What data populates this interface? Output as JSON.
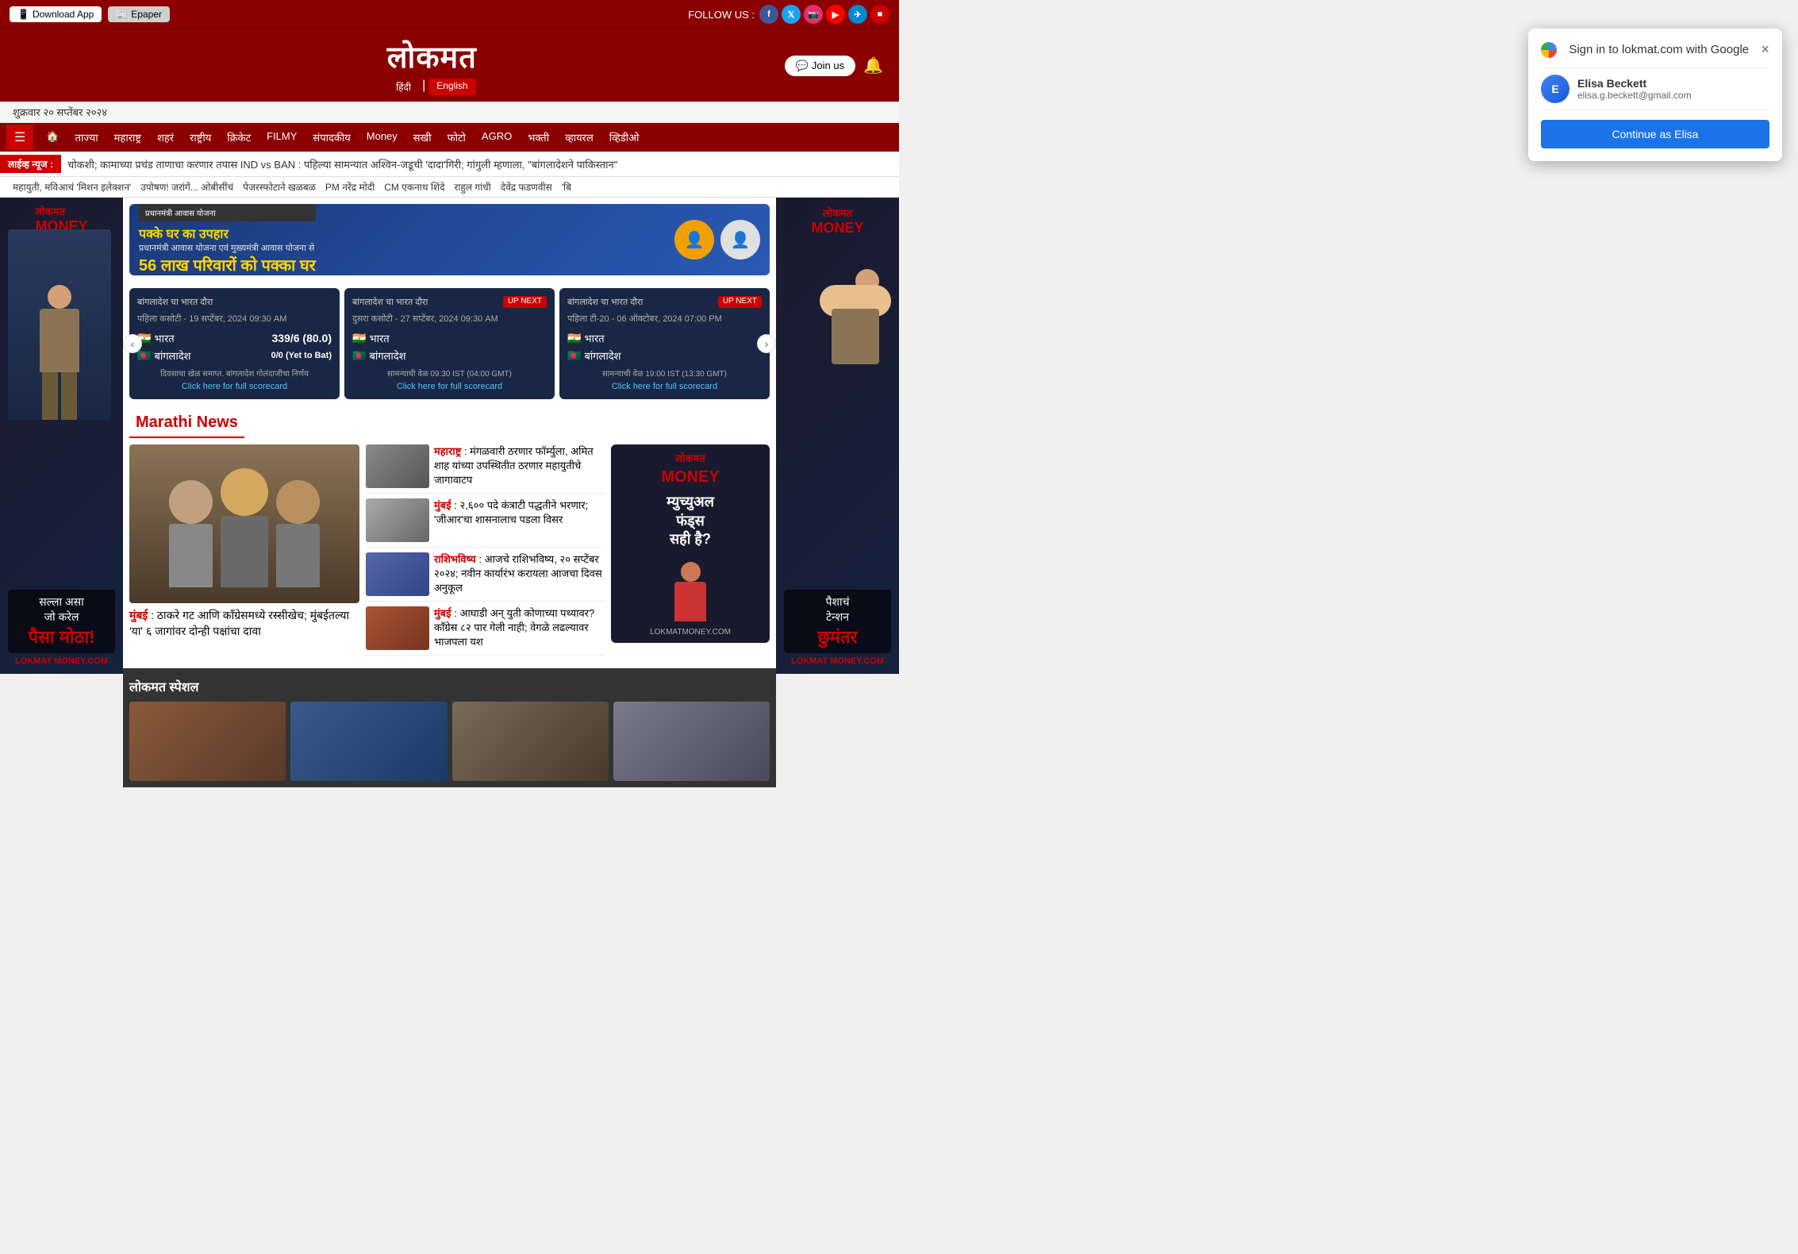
{
  "topbar": {
    "download_label": "Download App",
    "epaper_label": "Epaper",
    "follow_label": "FOLLOW US :",
    "social": [
      "f",
      "t",
      "ig",
      "yt",
      "tg"
    ]
  },
  "header": {
    "logo": "लोकमत",
    "lang_hindi": "हिंदी",
    "lang_english": "English",
    "join_label": "Join us"
  },
  "date_bar": {
    "date": "शुक्रवार २० सप्तेंबर २०२४"
  },
  "nav": {
    "hamburger": "☰",
    "items": [
      "🏠",
      "ताज्या",
      "महाराष्ट्र",
      "शहरं",
      "राष्ट्रीय",
      "क्रिकेट",
      "FILMY",
      "संपादकीय",
      "Money",
      "सखी",
      "फोटो",
      "AGRO",
      "भक्ती",
      "व्हायरल",
      "व्हिडीओ"
    ]
  },
  "breaking": {
    "label": "लाईव्ह न्यूज :",
    "text": "चोकशी; कामाच्या प्रचंड ताणाचा करणार तपास    IND vs BAN : पहिल्या सामन्यात अश्विन-जडूची 'दादा'गिरी; गांगुली म्हणाला, \"बांगलादेशने पाकिस्तान\""
  },
  "quick_links": [
    "महायुती, मविआचं 'मिशन इलेक्शन'",
    "उपोषण! जरांगें... ओबीसींचं",
    "पेजरस्फोटाने खळबळ",
    "PM नरेंद्र मोदी",
    "CM एकनाथ शिंदे",
    "राहुल गांधी",
    "देवेंद्र फडणवीस",
    "'बि"
  ],
  "banner_ad": {
    "title": "पक्के घर का उपहार",
    "subtitle": "प्रधानमंत्री आवास योजना एवं मुख्यमंत्री आवास योजना से",
    "main": "56 लाख परिवारों को पक्का घर"
  },
  "cricket": {
    "prev_label": "‹",
    "next_label": "›",
    "matches": [
      {
        "series": "बांगलादेश चा भारत दौरा",
        "badge": "",
        "match": "पहिला कसोटी - 19 सप्टेंबर, 2024 09:30 AM",
        "team1_flag": "🇮🇳",
        "team1": "भारत",
        "team1_score": "339/6 (80.0)",
        "team2_flag": "🇧🇩",
        "team2": "बांगलादेश",
        "team2_score": "0/0 (Yet to Bat)",
        "status": "दिवसाचा खेळ समाप्त. बांगलादेश गोलंदाजीचा निर्णय",
        "link": "Click here for full scorecard"
      },
      {
        "series": "बांगलादेश चा भारत दौरा",
        "badge": "UP NEXT",
        "match": "दुसरा कसोटी - 27 सप्टेंबर, 2024 09:30 AM",
        "team1_flag": "🇮🇳",
        "team1": "भारत",
        "team1_score": "",
        "team2_flag": "🇧🇩",
        "team2": "बांगलादेश",
        "team2_score": "",
        "status": "सामन्याची वेळ 09:30 IST (04:00 GMT)",
        "link": "Click here for full scorecard"
      },
      {
        "series": "बांगलादेश चा भारत दौरा",
        "badge": "UP NEXT",
        "match": "पहिला टी-20 - 06 ऑक्टोबर, 2024 07:00 PM",
        "team1_flag": "🇮🇳",
        "team1": "भारत",
        "team1_score": "",
        "team2_flag": "🇧🇩",
        "team2": "बांगलादेश",
        "team2_score": "",
        "status": "सामन्याची वेळ 19:00 IST (13:30 GMT)",
        "link": "Click here for full scorecard"
      }
    ]
  },
  "marathi_news": {
    "section_title": "Marathi News",
    "main_article": {
      "city": "मुंबई",
      "text": ": ठाकरे गट आणि काँग्रेसमध्ये रस्सीखेच; मुंबईतल्या 'या' ६ जागांवर दोन्ही पक्षांचा दावा"
    },
    "articles": [
      {
        "city": "महाराष्ट्र",
        "text": ": मंगळवारी ठरणार फॉर्म्युला, अमित शाह यांच्या उपस्थितीत ठरणार महायुतीचे जागावाटप"
      },
      {
        "city": "मुंबई",
        "text": ": २,६०० पदे कंत्राटी पद्धतीने भरणार; 'जीआर'चा शासनालाच पडला विसर"
      },
      {
        "city": "राशिभविष्य",
        "text": ": आजचे राशिभविष्य, २० सप्टेंबर २०२४; नवीन कार्यारंभ करायला आजचा दिवस अनुकूल"
      },
      {
        "city": "मुंबई",
        "text": ": आघाडी अन् युती कोणाच्या पथ्यावर? काँग्रेस ८२ पार गेली नाही; वेगळे लढल्यावर भाजपला यश"
      }
    ]
  },
  "lokmat_special": {
    "title": "लोकमत स्पेशल"
  },
  "left_ad": {
    "text1": "सल्ला असा",
    "text2": "जो करेल",
    "text3": "पैसा मोठा!",
    "logo": "LOKMAT MONEY.COM"
  },
  "right_ad": {
    "text1": "पैशाचं",
    "text2": "टेन्शन",
    "text3": "छुमंतर",
    "logo": "LOKMAT MONEY.COM"
  },
  "google_popup": {
    "title": "Sign in to lokmat.com with Google",
    "close_label": "×",
    "user_name": "Elisa Beckett",
    "user_email": "elisa.g.beckett@gmail.com",
    "user_initial": "E",
    "continue_label": "Continue as Elisa"
  },
  "money_ad": {
    "brand": "लोकमत",
    "brand2": "MONEY",
    "line1": "म्युच्युअल",
    "line2": "फंड्स",
    "line3": "सही है?",
    "logo": "LOKMATMONEY.COM"
  }
}
